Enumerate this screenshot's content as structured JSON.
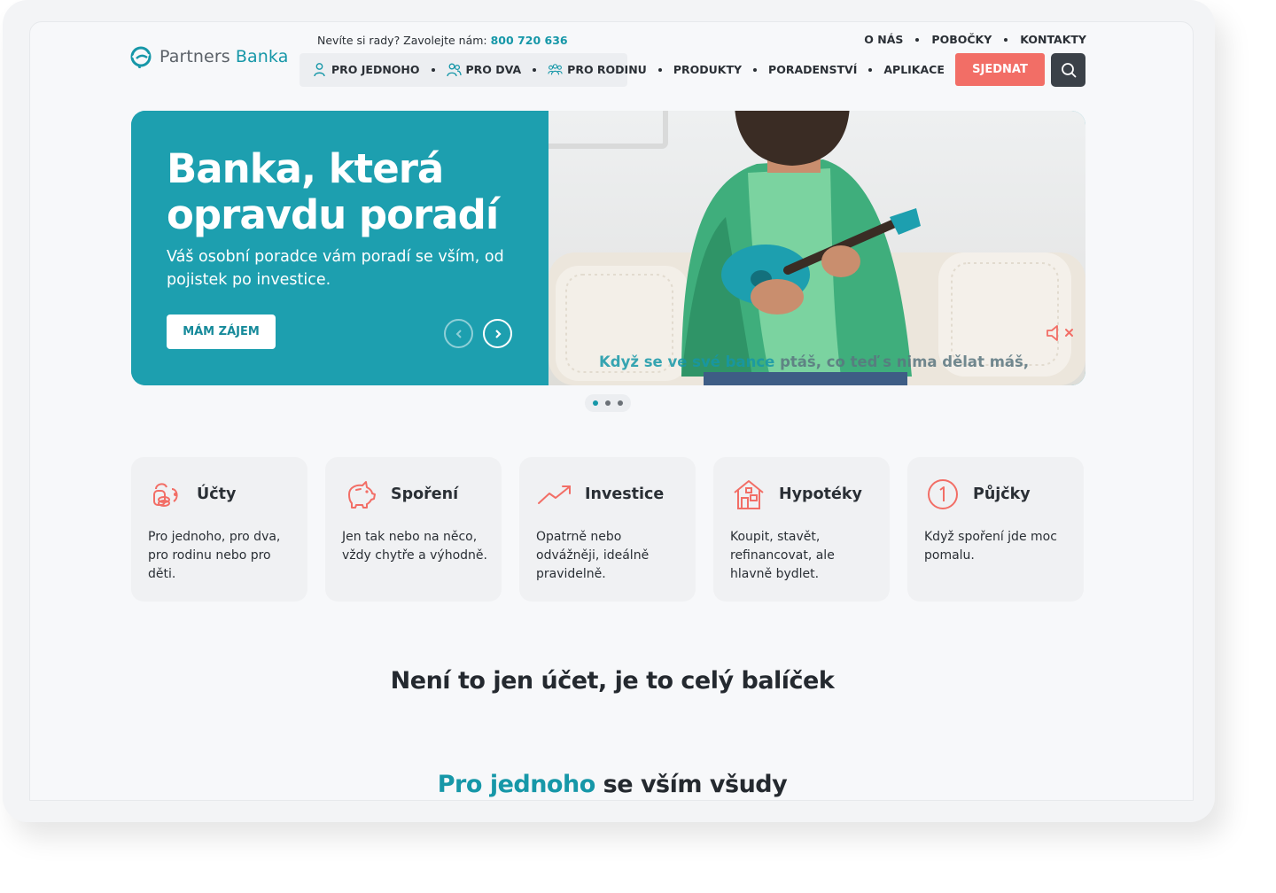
{
  "brand": {
    "name_part1": "Partners",
    "name_part2": "Banka",
    "accent": "#1697a8",
    "cta": "#f26e66"
  },
  "header": {
    "help_text": "Nevíte si rady? Zavolejte nám:",
    "phone": "800 720 636",
    "top_links": [
      "O NÁS",
      "POBOČKY",
      "KONTAKTY"
    ],
    "segments": [
      {
        "label": "PRO JEDNOHO",
        "icon": "person-icon"
      },
      {
        "label": "PRO DVA",
        "icon": "two-people-icon"
      },
      {
        "label": "PRO RODINU",
        "icon": "family-icon"
      }
    ],
    "nav": [
      "PRODUKTY",
      "PORADENSTVÍ",
      "APLIKACE"
    ],
    "book_label": "SJEDNAT",
    "search_icon": "search-icon"
  },
  "hero": {
    "title_line1": "Banka, která",
    "title_line2": "opravdu poradí",
    "subtitle": "Váš osobní poradce vám poradí se vším, od pojistek po investice.",
    "cta_label": "MÁM ZÁJEM",
    "caption_highlight": "Když se ve své bance",
    "caption_rest": " ptáš, co teď s nima dělat máš,",
    "slides_total": 3,
    "active_slide": 1
  },
  "products": [
    {
      "title": "Účty",
      "icon": "accounts-icon",
      "desc": "Pro jednoho, pro dva, pro rodinu nebo pro děti."
    },
    {
      "title": "Spoření",
      "icon": "piggy-bank-icon",
      "desc": "Jen tak nebo na něco, vždy chytře a výhodně."
    },
    {
      "title": "Investice",
      "icon": "trend-up-icon",
      "desc": "Opatrně nebo odvážněji, ideálně pravidelně."
    },
    {
      "title": "Hypotéky",
      "icon": "house-icon",
      "desc": "Koupit, stavět, refinancovat, ale hlavně bydlet."
    },
    {
      "title": "Půjčky",
      "icon": "loan-icon",
      "desc": "Když spoření jde moc pomalu."
    }
  ],
  "section": {
    "title": "Není to jen účet, je to celý balíček",
    "sub_highlight": "Pro jednoho",
    "sub_rest": " se vším všudy"
  }
}
